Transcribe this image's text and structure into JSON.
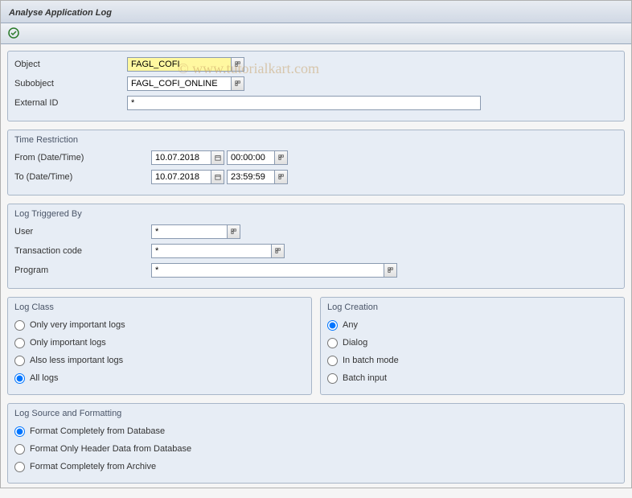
{
  "title": "Analyse Application Log",
  "watermark": "© www.tutorialkart.com",
  "selection": {
    "object_label": "Object",
    "object_value": "FAGL_COFI",
    "subobject_label": "Subobject",
    "subobject_value": "FAGL_COFI_ONLINE",
    "external_id_label": "External ID",
    "external_id_value": "*"
  },
  "time_restriction": {
    "title": "Time Restriction",
    "from_label": "From (Date/Time)",
    "from_date": "10.07.2018",
    "from_time": "00:00:00",
    "to_label": "To (Date/Time)",
    "to_date": "10.07.2018",
    "to_time": "23:59:59"
  },
  "log_triggered": {
    "title": "Log Triggered By",
    "user_label": "User",
    "user_value": "*",
    "tcode_label": "Transaction code",
    "tcode_value": "*",
    "program_label": "Program",
    "program_value": "*"
  },
  "log_class": {
    "title": "Log Class",
    "opt1": "Only very important logs",
    "opt2": "Only important logs",
    "opt3": "Also less important logs",
    "opt4": "All logs",
    "selected": "opt4"
  },
  "log_creation": {
    "title": "Log Creation",
    "opt1": "Any",
    "opt2": "Dialog",
    "opt3": "In batch mode",
    "opt4": "Batch input",
    "selected": "opt1"
  },
  "log_source": {
    "title": "Log Source and Formatting",
    "opt1": "Format Completely from Database",
    "opt2": "Format Only Header Data from Database",
    "opt3": "Format Completely from Archive",
    "selected": "opt1"
  }
}
